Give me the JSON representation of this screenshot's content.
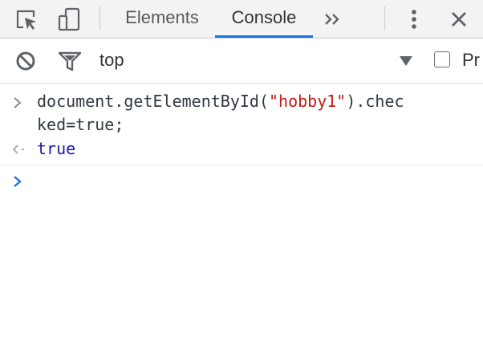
{
  "tabbar": {
    "tabs": [
      {
        "label": "Elements",
        "selected": false
      },
      {
        "label": "Console",
        "selected": true
      }
    ],
    "icons": [
      "inspect-element-icon",
      "device-toolbar-icon",
      "more-tabs-chevron-icon",
      "kebab-menu-icon",
      "close-icon"
    ],
    "accent_color": "#1a73e8"
  },
  "toolbar": {
    "context": "top",
    "preserve_log_label": "Pr",
    "preserve_log_checked": false,
    "icons": [
      "clear-console-icon",
      "filter-icon",
      "dropdown-arrow-icon"
    ]
  },
  "console": {
    "input_line_1": "document.getElementById(",
    "input_string": "\"hobby1\"",
    "input_line_1_rest": ").chec",
    "input_line_2": "ked=true;",
    "output_value": "true",
    "colors": {
      "string": "#c41a16",
      "result": "#1a1aa6",
      "prompt": "#1a73e8"
    }
  }
}
